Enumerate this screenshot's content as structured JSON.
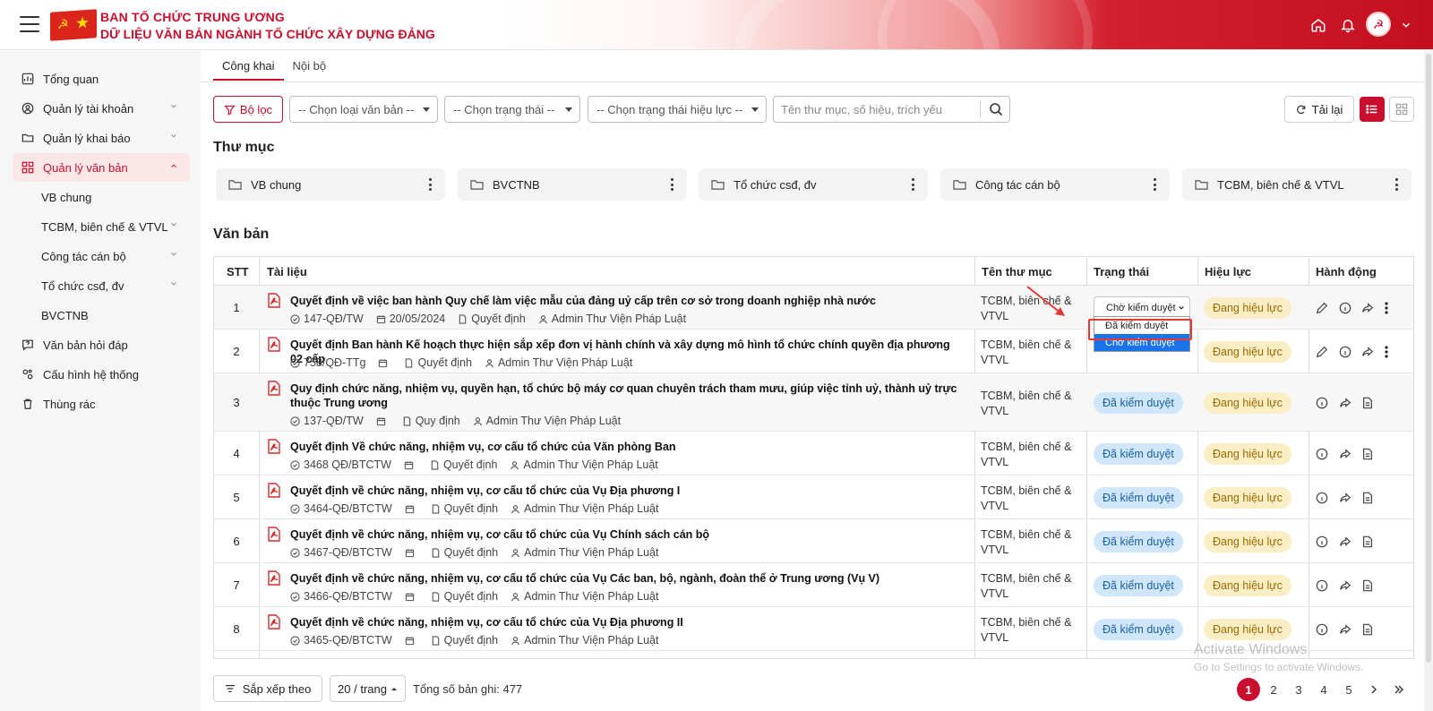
{
  "header": {
    "title_line1": "BAN TỔ CHỨC TRUNG ƯƠNG",
    "title_line2": "DỮ LIỆU VĂN BẢN NGÀNH TỔ CHỨC XÂY DỰNG ĐẢNG",
    "icons": [
      "menu-icon",
      "home-icon",
      "bell-icon",
      "avatar",
      "chevron-down-icon"
    ]
  },
  "sidebar": {
    "items": [
      {
        "label": "Tổng quan",
        "icon": "dashboard-icon"
      },
      {
        "label": "Quản lý tài khoản",
        "icon": "user-icon"
      },
      {
        "label": "Quản lý khai báo",
        "icon": "folder-icon"
      },
      {
        "label": "Quản lý văn bản",
        "icon": "grid-icon"
      },
      {
        "label": "Văn bản hỏi đáp",
        "icon": "help-icon"
      },
      {
        "label": "Cấu hình hệ thống",
        "icon": "settings-icon"
      },
      {
        "label": "Thùng rác",
        "icon": "trash-icon"
      }
    ],
    "sub_items": [
      "VB chung",
      "TCBM, biên chế & VTVL",
      "Công tác cán bộ",
      "Tổ chức csđ, đv",
      "BVCTNB"
    ]
  },
  "tabs": [
    "Công khai",
    "Nội bộ"
  ],
  "toolbar": {
    "filter_label": "Bộ lọc",
    "select_type": "-- Chọn loại văn bản --",
    "select_status": "-- Chọn trạng thái --",
    "select_validity": "-- Chọn trạng thái hiệu lực --",
    "search_placeholder": "Tên thư mục, số hiệu, trích yếu",
    "reload_label": "Tải lại"
  },
  "folders_title": "Thư mục",
  "folders": [
    "VB chung",
    "BVCTNB",
    "Tổ chức csđ, đv",
    "Công tác cán bộ",
    "TCBM, biên chế & VTVL"
  ],
  "documents_title": "Văn bản",
  "table": {
    "headers": [
      "STT",
      "Tài liệu",
      "Tên thư mục",
      "Trạng thái",
      "Hiệu lực",
      "Hành động"
    ],
    "rows": [
      {
        "stt": "1",
        "title": "Quyết định về việc ban hành Quy chế làm việc mẫu của đảng uỷ cấp trên cơ sở trong doanh nghiệp nhà nước",
        "code": "147-QĐ/TW",
        "date": "20/05/2024",
        "type": "Quyết định",
        "author": "Admin Thư Viện Pháp Luật",
        "folder": "TCBM, biên chế & VTVL",
        "status": "Chờ kiểm duyệt",
        "validity": "Đang hiệu lực"
      },
      {
        "stt": "2",
        "title": "Quyết định Ban hành Kế hoạch thực hiện sắp xếp đơn vị hành chính và xây dựng mô hình tổ chức chính quyền địa phương 02 cấp",
        "code": "758/QĐ-TTg",
        "date": "",
        "type": "Quyết định",
        "author": "Admin Thư Viện Pháp Luật",
        "folder": "TCBM, biên chế & VTVL",
        "status": "",
        "validity": "Đang hiệu lực"
      },
      {
        "stt": "3",
        "title": "Quy định chức năng, nhiệm vụ, quyền hạn, tổ chức bộ máy cơ quan chuyên trách tham mưu, giúp việc tỉnh uỷ, thành uỷ trực thuộc Trung ương",
        "code": "137-QĐ/TW",
        "date": "",
        "type": "Quy định",
        "author": "Admin Thư Viện Pháp Luật",
        "folder": "TCBM, biên chế & VTVL",
        "status": "Đã kiểm duyệt",
        "validity": "Đang hiệu lực"
      },
      {
        "stt": "4",
        "title": "Quyết định Về chức năng, nhiệm vụ, cơ cấu tổ chức của Văn phòng Ban",
        "code": "3468 QĐ/BTCTW",
        "date": "",
        "type": "Quyết định",
        "author": "Admin Thư Viện Pháp Luật",
        "folder": "TCBM, biên chế & VTVL",
        "status": "Đã kiểm duyệt",
        "validity": "Đang hiệu lực"
      },
      {
        "stt": "5",
        "title": "Quyết định về chức năng, nhiệm vụ, cơ cấu tổ chức của Vụ Địa phương I",
        "code": "3464-QĐ/BTCTW",
        "date": "",
        "type": "Quyết định",
        "author": "Admin Thư Viện Pháp Luật",
        "folder": "TCBM, biên chế & VTVL",
        "status": "Đã kiểm duyệt",
        "validity": "Đang hiệu lực"
      },
      {
        "stt": "6",
        "title": "Quyết định về chức năng, nhiệm vụ, cơ cấu tổ chức của Vụ Chính sách cán bộ",
        "code": "3467-QĐ/BTCTW",
        "date": "",
        "type": "Quyết định",
        "author": "Admin Thư Viện Pháp Luật",
        "folder": "TCBM, biên chế & VTVL",
        "status": "Đã kiểm duyệt",
        "validity": "Đang hiệu lực"
      },
      {
        "stt": "7",
        "title": "Quyết định về chức năng, nhiệm vụ, cơ cấu tổ chức của Vụ Các ban, bộ, ngành, đoàn thể ở Trung ương (Vụ V)",
        "code": "3466-QĐ/BTCTW",
        "date": "",
        "type": "Quyết định",
        "author": "Admin Thư Viện Pháp Luật",
        "folder": "TCBM, biên chế & VTVL",
        "status": "Đã kiểm duyệt",
        "validity": "Đang hiệu lực"
      },
      {
        "stt": "8",
        "title": "Quyết định về chức năng, nhiệm vụ, cơ cấu tổ chức của Vụ Địa phương II",
        "code": "3465-QĐ/BTCTW",
        "date": "",
        "type": "Quyết định",
        "author": "Admin Thư Viện Pháp Luật",
        "folder": "TCBM, biên chế & VTVL",
        "status": "Đã kiểm duyệt",
        "validity": "Đang hiệu lực"
      }
    ]
  },
  "status_dropdown": {
    "selected": "Chờ kiểm duyệt",
    "options": [
      "Đã kiểm duyệt",
      "Chờ kiểm duyệt"
    ]
  },
  "footer": {
    "sort_label": "Sắp xếp theo",
    "per_page": "20 / trang",
    "total": "Tổng số bản ghi: 477",
    "pages": [
      "1",
      "2",
      "3",
      "4",
      "5"
    ],
    "current_page": "1"
  },
  "watermark": {
    "line1": "Activate Windows",
    "line2": "Go to Settings to activate Windows."
  },
  "colors": {
    "brand": "#c8102e",
    "badge_blue_bg": "#cfe6fb",
    "badge_yellow_bg": "#fbeec4",
    "highlight": "#e53935"
  }
}
